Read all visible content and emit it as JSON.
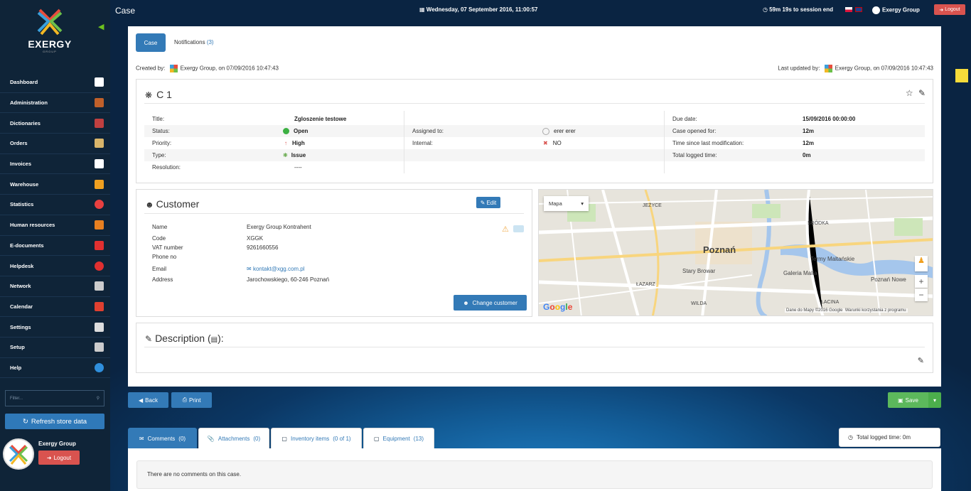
{
  "app": {
    "title": "Case",
    "brand": "EXERGY",
    "brand_sub": "GROUP",
    "accent": "#337ab7"
  },
  "topbar": {
    "datetime": "Wednesday, 07 September 2016, 11:00:57",
    "session": "59m 19s to session end",
    "company": "Exergy Group",
    "logout": "Logout"
  },
  "sidebar": {
    "items": [
      {
        "label": "Dashboard",
        "icon": "home-icon",
        "color": "#ffffff"
      },
      {
        "label": "Administration",
        "icon": "books-icon",
        "color": "#c0602a"
      },
      {
        "label": "Dictionaries",
        "icon": "book-icon",
        "color": "#c04040"
      },
      {
        "label": "Orders",
        "icon": "box-icon",
        "color": "#d9b56a"
      },
      {
        "label": "Invoices",
        "icon": "document-icon",
        "color": "#ffffff"
      },
      {
        "label": "Warehouse",
        "icon": "forklift-icon",
        "color": "#f0a020"
      },
      {
        "label": "Statistics",
        "icon": "pie-chart-icon",
        "color": "#e84040"
      },
      {
        "label": "Human resources",
        "icon": "pushpin-icon",
        "color": "#e88020"
      },
      {
        "label": "E-documents",
        "icon": "pdf-icon",
        "color": "#e03030"
      },
      {
        "label": "Helpdesk",
        "icon": "lifebuoy-icon",
        "color": "#e03030"
      },
      {
        "label": "Network",
        "icon": "network-icon",
        "color": "#cccccc"
      },
      {
        "label": "Calendar",
        "icon": "calendar-icon",
        "color": "#e04030"
      },
      {
        "label": "Settings",
        "icon": "gear-icon",
        "color": "#dddddd"
      },
      {
        "label": "Setup",
        "icon": "setup-icon",
        "color": "#cccccc"
      },
      {
        "label": "Help",
        "icon": "help-icon",
        "color": "#2f8fdc"
      }
    ],
    "filter_placeholder": "Filter...",
    "refresh": "Refresh store data",
    "user": "Exergy Group",
    "logout": "Logout"
  },
  "tabs": {
    "case": "Case",
    "notifications": "Notifications",
    "notifications_count": "(3)"
  },
  "meta": {
    "created_label": "Created by:",
    "created_value": "Exergy Group, on 07/09/2016 10:47:43",
    "updated_label": "Last updated by:",
    "updated_value": "Exergy Group, on 07/09/2016 10:47:43"
  },
  "case": {
    "id": "C 1",
    "fields": {
      "title_label": "Title:",
      "title": "Zgloszenie testowe",
      "status_label": "Status:",
      "status": "Open",
      "status_color": "#3cb043",
      "priority_label": "Priority:",
      "priority": "High",
      "type_label": "Type:",
      "type": "Issue",
      "resolution_label": "Resolution:",
      "resolution": "----",
      "assigned_label": "Assigned to:",
      "assigned": "erer erer",
      "internal_label": "Internal:",
      "internal": "NO",
      "due_label": "Due date:",
      "due": "15/09/2016 00:00:00",
      "opened_label": "Case opened for:",
      "opened": "12m",
      "since_label": "Time since last modification:",
      "since": "12m",
      "logged_label": "Total logged time:",
      "logged": "0m"
    }
  },
  "customer": {
    "title": "Customer",
    "edit": "Edit",
    "name_label": "Name",
    "name": "Exergy Group Kontrahent",
    "code_label": "Code",
    "code": "XGGK",
    "vat_label": "VAT number",
    "vat": "9261660556",
    "phone_label": "Phone no",
    "email_label": "Email",
    "email": "kontakt@xgg.com.pl",
    "address_label": "Address",
    "address": "Jarochowskiego, 60-246 Poznań",
    "change": "Change customer"
  },
  "map": {
    "type": "Mapa",
    "city": "Poznań",
    "labels": [
      "JEŻYCE",
      "ŚRÓDKA",
      "Stary Browar",
      "Galeria Malta",
      "Termy Maltańskie",
      "ŁAZARZ",
      "WILDA",
      "ŁACINA",
      "Poznań Nowe"
    ],
    "copyright": "Dane do Mapy ©2016 Google",
    "terms": "Warunki korzystania z programu"
  },
  "description": {
    "title": "Description (",
    "title_end": "):"
  },
  "actions": {
    "back": "Back",
    "print": "Print",
    "save": "Save"
  },
  "bottom_tabs": [
    {
      "label": "Comments",
      "count": "(0)",
      "icon": "comments-icon"
    },
    {
      "label": "Attachments",
      "count": "(0)",
      "icon": "paperclip-icon"
    },
    {
      "label": "Inventory items",
      "count": "(0 of 1)",
      "icon": "briefcase-icon"
    },
    {
      "label": "Equipment",
      "count": "(13)",
      "icon": "briefcase-icon"
    }
  ],
  "total_logged": "Total logged time: 0m",
  "comments_empty": "There are no comments on this case."
}
